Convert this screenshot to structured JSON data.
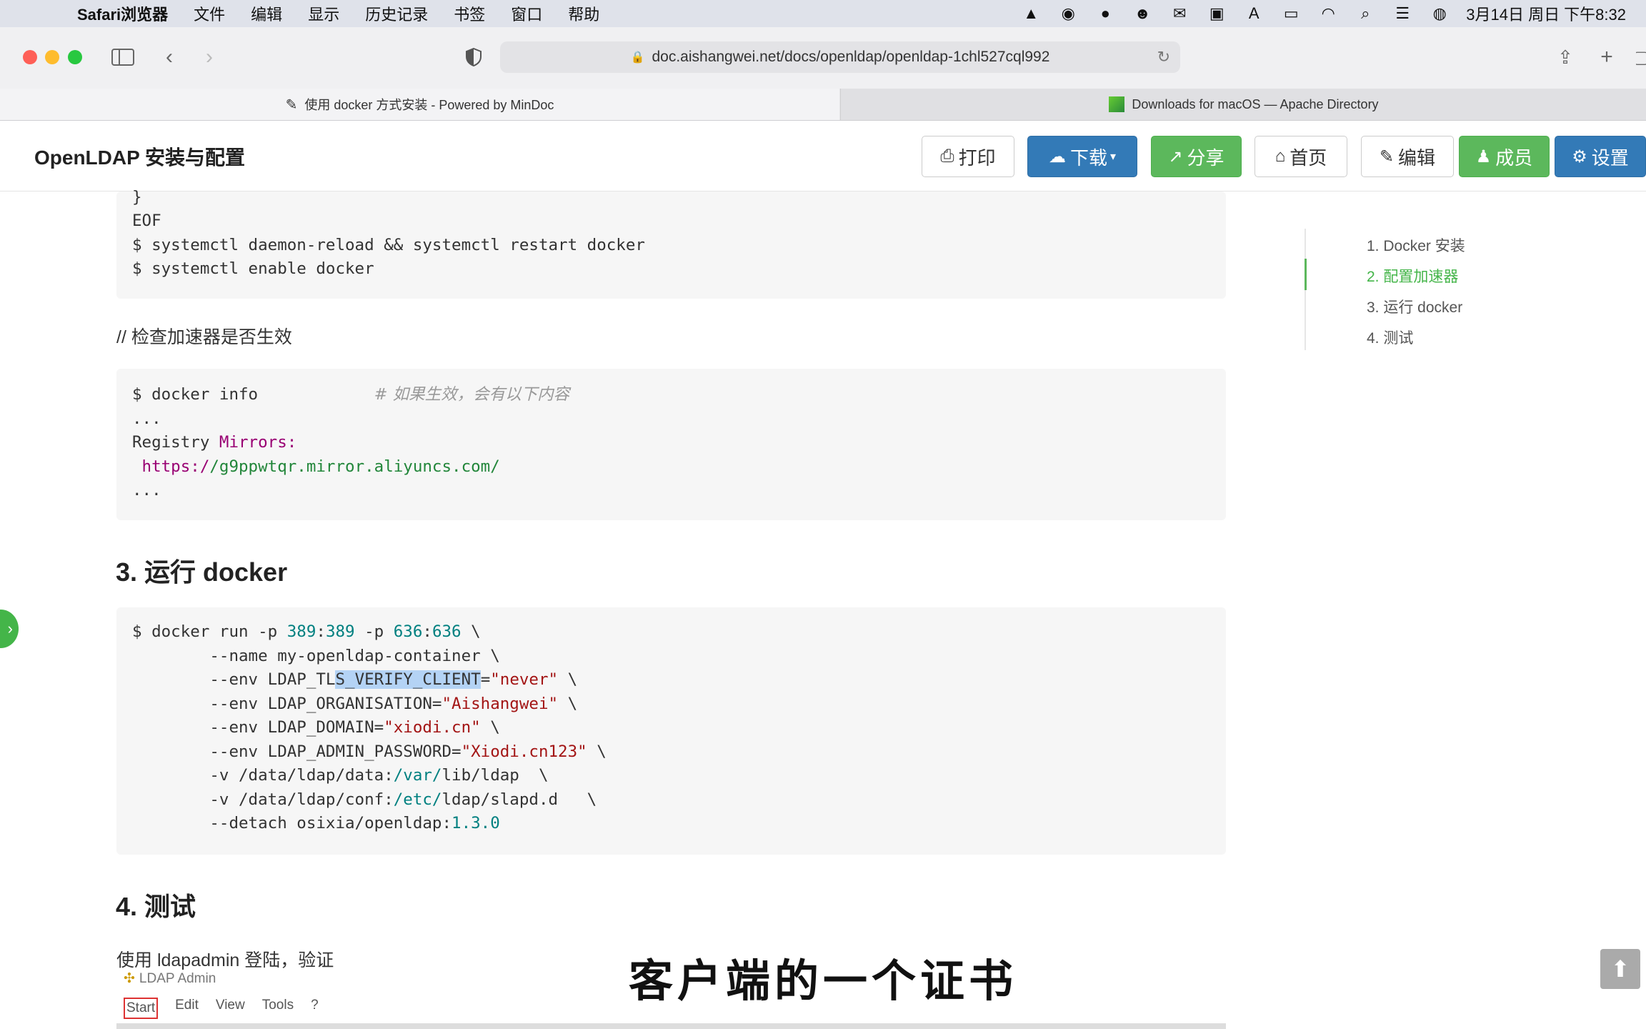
{
  "menubar": {
    "app": "Safari浏览器",
    "items": [
      "文件",
      "编辑",
      "显示",
      "历史记录",
      "书签",
      "窗口",
      "帮助"
    ],
    "clock": "3月14日 周日 下午8:32"
  },
  "browser": {
    "url": "doc.aishangwei.net/docs/openldap/openldap-1chl527cql992",
    "tabs": [
      {
        "title": "使用 docker 方式安装 - Powered by MinDoc"
      },
      {
        "title": "Downloads for macOS — Apache Directory"
      }
    ]
  },
  "doc": {
    "title": "OpenLDAP 安装与配置",
    "buttons": {
      "print": "打印",
      "download": "下载",
      "share": "分享",
      "home": "首页",
      "edit": "编辑",
      "members": "成员",
      "settings": "设置"
    }
  },
  "code1": {
    "l1": "}",
    "l2": "EOF",
    "l3": "$ systemctl daemon-reload && systemctl restart docker",
    "l4": "$ systemctl enable docker"
  },
  "para_check": "// 检查加速器是否生效",
  "code2": {
    "l1_cmd": "$ docker info            ",
    "l1_comment": "# 如果生效，会有以下内容",
    "l2": "...",
    "l3_a": "Registry ",
    "l3_b": "Mirrors:",
    "l4_a": " https:/",
    "l4_b": "/g9ppwtqr.mirror.aliyuncs.com/",
    "l5": "..."
  },
  "section3": "3. 运行 docker",
  "code3": {
    "l1_a": "$ docker run -p ",
    "l1_b": "389",
    "l1_c": ":",
    "l1_d": "389",
    "l1_e": " -p ",
    "l1_f": "636",
    "l1_g": ":",
    "l1_h": "636",
    "l1_i": " \\",
    "l2": "        --name my-openldap-container \\",
    "l3_a": "        --env LDAP_TL",
    "l3_sel": "S_VERIFY_CLIENT",
    "l3_b": "=",
    "l3_str": "\"never\"",
    "l3_c": " \\",
    "l4_a": "        --env LDAP_ORGANISATION=",
    "l4_str": "\"Aishangwei\"",
    "l4_c": " \\",
    "l5_a": "        --env LDAP_DOMAIN=",
    "l5_str": "\"xiodi.cn\"",
    "l5_c": " \\",
    "l6_a": "        --env LDAP_ADMIN_PASSWORD=",
    "l6_str": "\"Xiodi.cn123\"",
    "l6_c": " \\",
    "l7_a": "        -v /data/ldap/data:",
    "l7_b": "/var/",
    "l7_c": "lib/ldap  \\",
    "l8_a": "        -v /data/ldap/conf:",
    "l8_b": "/etc/",
    "l8_c": "ldap/slapd.d   \\",
    "l9_a": "        --detach osixia/openldap:",
    "l9_b": "1.3.0"
  },
  "section4": "4. 测试",
  "para_login": "使用 ldapadmin 登陆，验证",
  "ldap_admin": {
    "title": "LDAP Admin",
    "menu": [
      "Start",
      "Edit",
      "View",
      "Tools",
      "?"
    ]
  },
  "toc": [
    {
      "label": "1. Docker 安装"
    },
    {
      "label": "2. 配置加速器"
    },
    {
      "label": "3. 运行 docker"
    },
    {
      "label": "4. 测试"
    }
  ],
  "subtitle": "客户端的一个证书",
  "colors": {
    "blue_button": "#337ab7",
    "green_button": "#5cb85c",
    "toc_active": "#44b549"
  }
}
